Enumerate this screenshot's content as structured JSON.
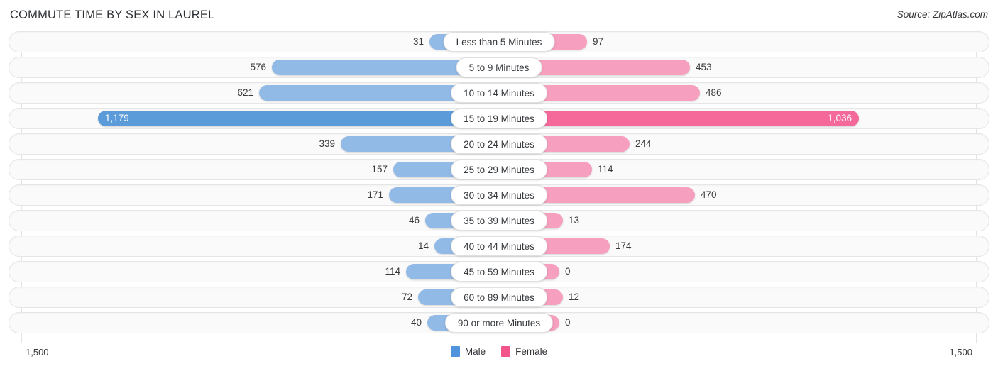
{
  "header": {
    "title": "COMMUTE TIME BY SEX IN LAUREL",
    "source": "Source: ZipAtlas.com"
  },
  "footer": {
    "axis_max_left": "1,500",
    "axis_max_right": "1,500",
    "legend": [
      {
        "label": "Male",
        "color": "#4f93dd"
      },
      {
        "label": "Female",
        "color": "#f2558c"
      }
    ]
  },
  "colors": {
    "male_bar": "#92bae6",
    "female_bar": "#f79fbe",
    "male_bar_peak": "#5b9bd9",
    "female_bar_peak": "#f4699a",
    "track": "#fafafa",
    "axis": "#e3e3e3"
  },
  "chart_data": {
    "type": "bar",
    "title": "COMMUTE TIME BY SEX IN LAUREL",
    "subtitle": "",
    "orientation": "horizontal-diverging",
    "xlabel": "",
    "ylabel": "",
    "axis_max": 1500,
    "xlim": [
      -1500,
      1500
    ],
    "grid": false,
    "legend_position": "bottom-center",
    "categories": [
      "Less than 5 Minutes",
      "5 to 9 Minutes",
      "10 to 14 Minutes",
      "15 to 19 Minutes",
      "20 to 24 Minutes",
      "25 to 29 Minutes",
      "30 to 34 Minutes",
      "35 to 39 Minutes",
      "40 to 44 Minutes",
      "45 to 59 Minutes",
      "60 to 89 Minutes",
      "90 or more Minutes"
    ],
    "series": [
      {
        "name": "Male",
        "color": "#92bae6",
        "values": [
          31,
          576,
          621,
          1179,
          339,
          157,
          171,
          46,
          14,
          114,
          72,
          40
        ],
        "labels": [
          "31",
          "576",
          "621",
          "1,179",
          "339",
          "157",
          "171",
          "46",
          "14",
          "114",
          "72",
          "40"
        ]
      },
      {
        "name": "Female",
        "color": "#f79fbe",
        "values": [
          97,
          453,
          486,
          1036,
          244,
          114,
          470,
          13,
          174,
          0,
          12,
          0
        ],
        "labels": [
          "97",
          "453",
          "486",
          "1,036",
          "244",
          "114",
          "470",
          "13",
          "174",
          "0",
          "12",
          "0"
        ]
      }
    ],
    "highlighted_category": "15 to 19 Minutes"
  }
}
